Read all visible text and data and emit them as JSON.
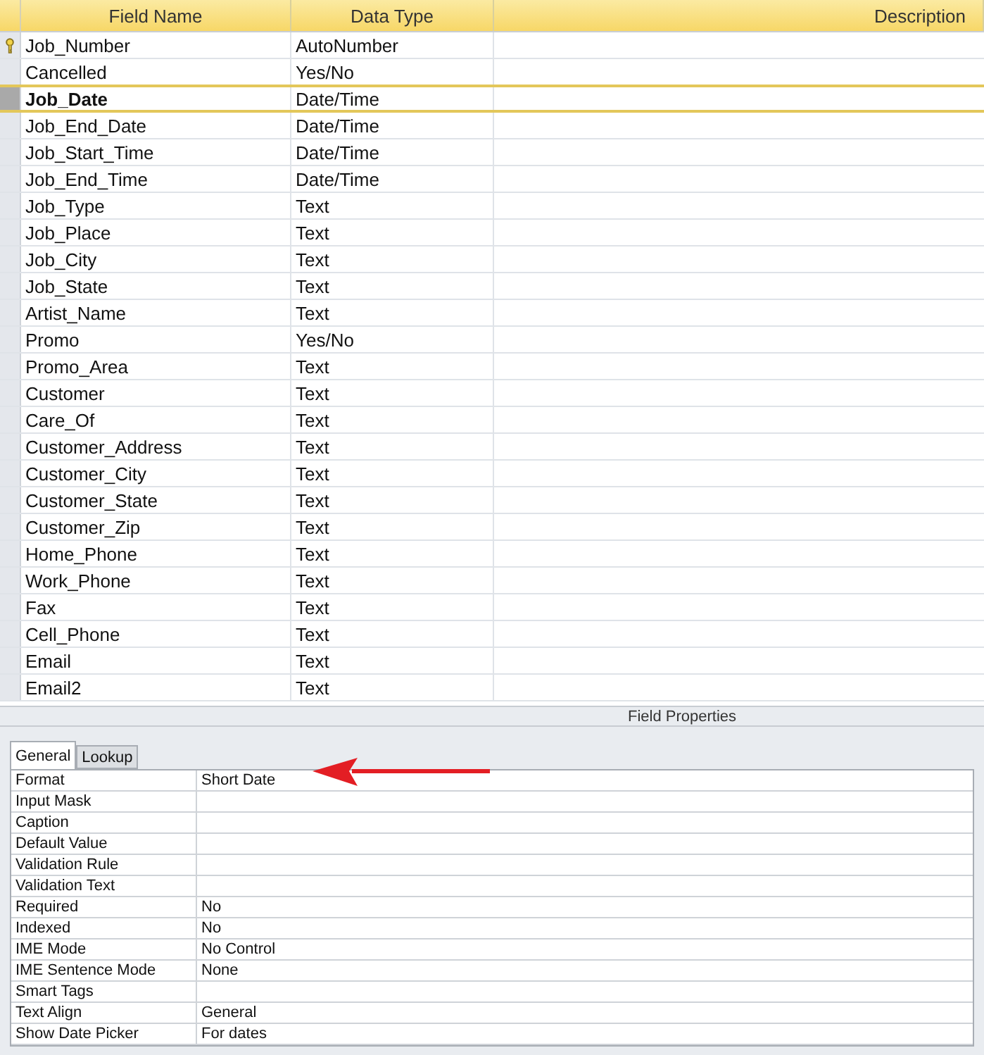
{
  "columns": [
    "Field Name",
    "Data Type",
    "Description"
  ],
  "fields": [
    {
      "name": "Job_Number",
      "type": "AutoNumber",
      "primary_key": true,
      "selected": false
    },
    {
      "name": "Cancelled",
      "type": "Yes/No",
      "primary_key": false,
      "selected": false
    },
    {
      "name": "Job_Date",
      "type": "Date/Time",
      "primary_key": false,
      "selected": true
    },
    {
      "name": "Job_End_Date",
      "type": "Date/Time",
      "primary_key": false,
      "selected": false
    },
    {
      "name": "Job_Start_Time",
      "type": "Date/Time",
      "primary_key": false,
      "selected": false
    },
    {
      "name": "Job_End_Time",
      "type": "Date/Time",
      "primary_key": false,
      "selected": false
    },
    {
      "name": "Job_Type",
      "type": "Text",
      "primary_key": false,
      "selected": false
    },
    {
      "name": "Job_Place",
      "type": "Text",
      "primary_key": false,
      "selected": false
    },
    {
      "name": "Job_City",
      "type": "Text",
      "primary_key": false,
      "selected": false
    },
    {
      "name": "Job_State",
      "type": "Text",
      "primary_key": false,
      "selected": false
    },
    {
      "name": "Artist_Name",
      "type": "Text",
      "primary_key": false,
      "selected": false
    },
    {
      "name": "Promo",
      "type": "Yes/No",
      "primary_key": false,
      "selected": false
    },
    {
      "name": "Promo_Area",
      "type": "Text",
      "primary_key": false,
      "selected": false
    },
    {
      "name": "Customer",
      "type": "Text",
      "primary_key": false,
      "selected": false
    },
    {
      "name": "Care_Of",
      "type": "Text",
      "primary_key": false,
      "selected": false
    },
    {
      "name": "Customer_Address",
      "type": "Text",
      "primary_key": false,
      "selected": false
    },
    {
      "name": "Customer_City",
      "type": "Text",
      "primary_key": false,
      "selected": false
    },
    {
      "name": "Customer_State",
      "type": "Text",
      "primary_key": false,
      "selected": false
    },
    {
      "name": "Customer_Zip",
      "type": "Text",
      "primary_key": false,
      "selected": false
    },
    {
      "name": "Home_Phone",
      "type": "Text",
      "primary_key": false,
      "selected": false
    },
    {
      "name": "Work_Phone",
      "type": "Text",
      "primary_key": false,
      "selected": false
    },
    {
      "name": "Fax",
      "type": "Text",
      "primary_key": false,
      "selected": false
    },
    {
      "name": "Cell_Phone",
      "type": "Text",
      "primary_key": false,
      "selected": false
    },
    {
      "name": "Email",
      "type": "Text",
      "primary_key": false,
      "selected": false
    },
    {
      "name": "Email2",
      "type": "Text",
      "primary_key": false,
      "selected": false
    }
  ],
  "field_properties": {
    "title": "Field Properties",
    "tabs": [
      {
        "label": "General",
        "selected": true
      },
      {
        "label": "Lookup",
        "selected": false
      }
    ],
    "properties": [
      {
        "label": "Format",
        "value": "Short Date"
      },
      {
        "label": "Input Mask"
      },
      {
        "label": "Caption"
      },
      {
        "label": "Default Value"
      },
      {
        "label": "Validation Rule"
      },
      {
        "label": "Validation Text"
      },
      {
        "label": "Required",
        "value": "No"
      },
      {
        "label": "Indexed",
        "value": "No"
      },
      {
        "label": "IME Mode",
        "value": "No Control"
      },
      {
        "label": "IME Sentence Mode",
        "value": "None"
      },
      {
        "label": "Smart Tags"
      },
      {
        "label": "Text Align",
        "value": "General"
      },
      {
        "label": "Show Date Picker",
        "value": "For dates"
      }
    ]
  }
}
